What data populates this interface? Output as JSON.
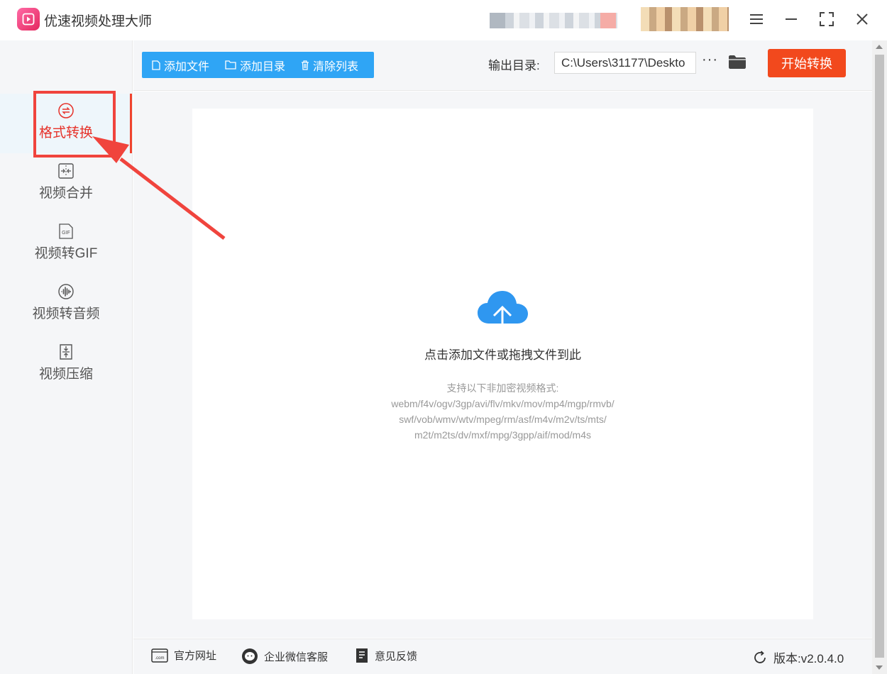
{
  "app": {
    "title": "优速视频处理大师"
  },
  "sidebar": {
    "items": [
      {
        "label": "格式转换",
        "icon": "format-convert-icon",
        "active": true
      },
      {
        "label": "视频合并",
        "icon": "merge-icon"
      },
      {
        "label": "视频转GIF",
        "icon": "gif-icon"
      },
      {
        "label": "视频转音频",
        "icon": "audio-icon"
      },
      {
        "label": "视频压缩",
        "icon": "compress-icon"
      }
    ]
  },
  "toolbar": {
    "add_file": "添加文件",
    "add_folder": "添加目录",
    "clear_list": "清除列表",
    "output_label": "输出目录:",
    "output_path": "C:\\Users\\31177\\Deskto",
    "more": "···",
    "start": "开始转换"
  },
  "drop": {
    "title": "点击添加文件或拖拽文件到此",
    "formats_label": "支持以下非加密视频格式:",
    "formats_line1": "webm/f4v/ogv/3gp/avi/flv/mkv/mov/mp4/mgp/rmvb/",
    "formats_line2": "swf/vob/wmv/wtv/mpeg/rm/asf/m4v/m2v/ts/mts/",
    "formats_line3": "m2t/m2ts/dv/mxf/mpg/3gpp/aif/mod/m4s"
  },
  "footer": {
    "website": "官方网址",
    "wechat": "企业微信客服",
    "feedback": "意见反馈",
    "version": "版本:v2.0.4.0"
  },
  "colors": {
    "accent": "#2fa5f5",
    "start": "#f2491d",
    "highlight": "#f0443d"
  }
}
